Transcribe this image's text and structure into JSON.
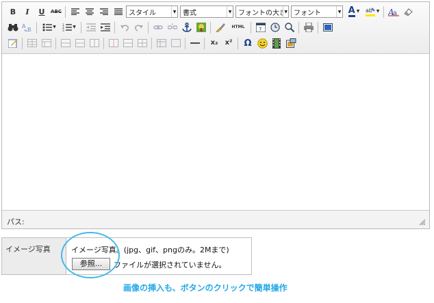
{
  "toolbar": {
    "row1": {
      "bold": "B",
      "italic": "I",
      "underline": "U",
      "strike": "ABC",
      "style_combo": "スタイル",
      "format_combo": "書式",
      "size_combo": "フォントの大きさ",
      "font_combo": "フォント",
      "text_color": "A"
    },
    "row2": {
      "source": "HTML"
    },
    "row3": {
      "subscript": "x₂",
      "superscript": "x²",
      "special_char": "Ω"
    }
  },
  "statusbar": {
    "path_label": "パス:"
  },
  "upload": {
    "label": "イメージ写真",
    "hint": "イメージ写真。(jpg、gif、pngのみ。2Mまで)",
    "browse_button": "参照...",
    "no_file_text": "ファイルが選択されていません。"
  },
  "caption": "画像の挿入も、ボタンのクリックで簡単操作",
  "colors": {
    "accent": "#23a8e8",
    "highlight_ring": "#43b8e8",
    "toolbar_bg": "#efefef"
  }
}
